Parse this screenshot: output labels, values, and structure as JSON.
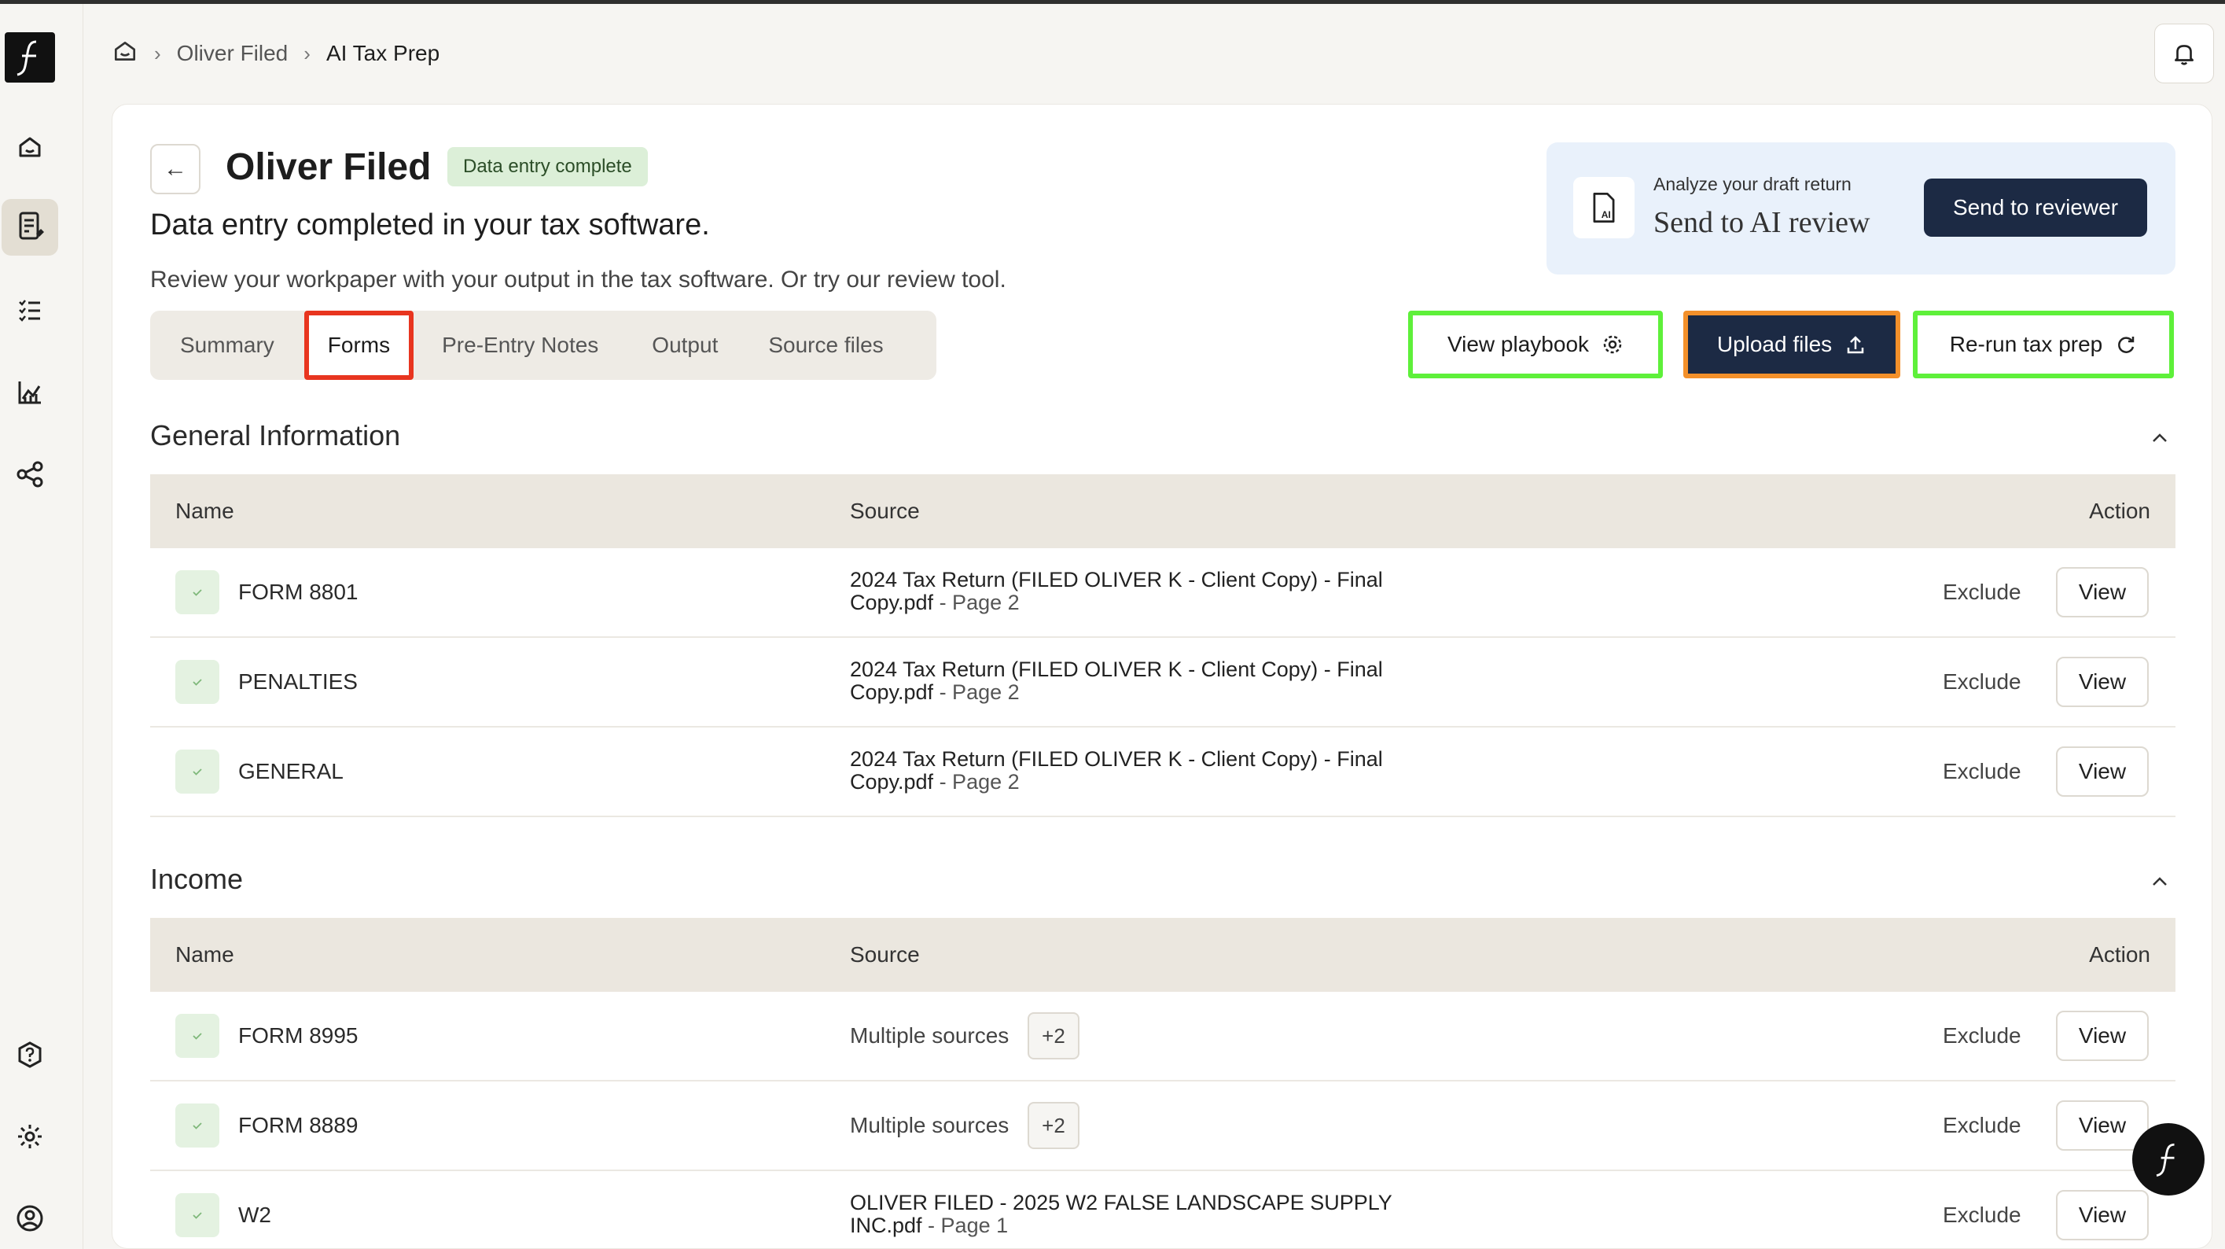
{
  "breadcrumb": {
    "client": "Oliver Filed",
    "current": "AI Tax Prep"
  },
  "header": {
    "client_name": "Oliver Filed",
    "status": "Data entry complete",
    "headline": "Data entry completed in your tax software.",
    "subtext": "Review your workpaper with your output in the tax software. Or try our review tool."
  },
  "ai_review": {
    "caption": "Analyze your draft return",
    "title": "Send to AI review",
    "send_label": "Send to reviewer"
  },
  "tabs": [
    {
      "label": "Summary"
    },
    {
      "label": "Forms"
    },
    {
      "label": "Pre-Entry Notes"
    },
    {
      "label": "Output"
    },
    {
      "label": "Source files"
    }
  ],
  "actions": {
    "playbook_label": "View playbook",
    "upload_label": "Upload files",
    "rerun_label": "Re-run tax prep"
  },
  "table_headers": {
    "name": "Name",
    "source": "Source",
    "action": "Action"
  },
  "row_actions": {
    "exclude": "Exclude",
    "view": "View"
  },
  "sections": [
    {
      "title": "General Information",
      "rows": [
        {
          "name": "FORM 8801",
          "source_line1": "2024 Tax Return (FILED OLIVER K - Client Copy) - Final",
          "source_line2": "Copy.pdf",
          "page": " - Page 2"
        },
        {
          "name": "PENALTIES",
          "source_line1": "2024 Tax Return (FILED OLIVER K - Client Copy) - Final",
          "source_line2": "Copy.pdf",
          "page": " - Page 2"
        },
        {
          "name": "GENERAL",
          "source_line1": "2024 Tax Return (FILED OLIVER K - Client Copy) - Final",
          "source_line2": "Copy.pdf",
          "page": " - Page 2"
        }
      ]
    },
    {
      "title": "Income",
      "rows": [
        {
          "name": "FORM 8995",
          "multi": "Multiple sources",
          "extra": "+2"
        },
        {
          "name": "FORM 8889",
          "multi": "Multiple sources",
          "extra": "+2"
        },
        {
          "name": "W2",
          "source_line1": "OLIVER FILED - 2025 W2 FALSE LANDSCAPE SUPPLY",
          "source_line2": "INC.pdf",
          "page": " - Page 1"
        }
      ]
    }
  ],
  "colors": {
    "navy": "#1c2a44",
    "green_highlight": "#5ef03a",
    "orange_highlight": "#f3902a",
    "red_highlight": "#e8351f"
  }
}
